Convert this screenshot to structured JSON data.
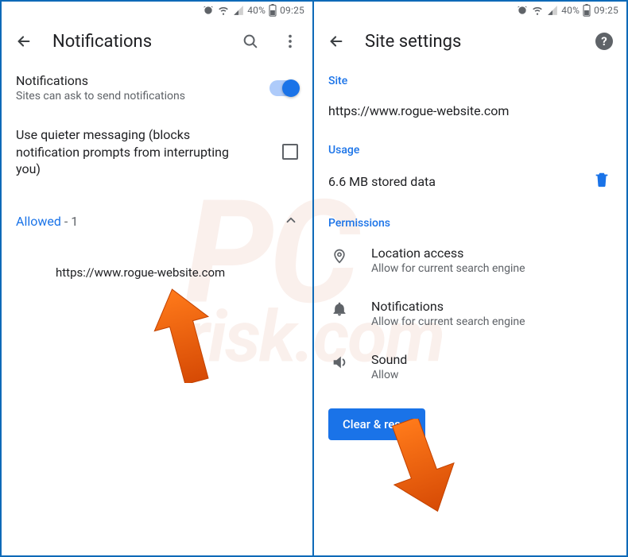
{
  "status": {
    "battery": "40%",
    "time": "09:25"
  },
  "left": {
    "title": "Notifications",
    "notif_label": "Notifications",
    "notif_sub": "Sites can ask to send notifications",
    "quieter": "Use quieter messaging (blocks notification prompts from interrupting you)",
    "allowed_label": "Allowed",
    "allowed_count": "1",
    "site": "https://www.rogue-website.com"
  },
  "right": {
    "title": "Site settings",
    "section_site": "Site",
    "site_url": "https://www.rogue-website.com",
    "section_usage": "Usage",
    "usage_text": "6.6 MB stored data",
    "section_permissions": "Permissions",
    "perm_location_title": "Location access",
    "perm_location_sub": "Allow for current search engine",
    "perm_notif_title": "Notifications",
    "perm_notif_sub": "Allow for current search engine",
    "perm_sound_title": "Sound",
    "perm_sound_sub": "Allow",
    "clear_btn": "Clear & reset"
  }
}
